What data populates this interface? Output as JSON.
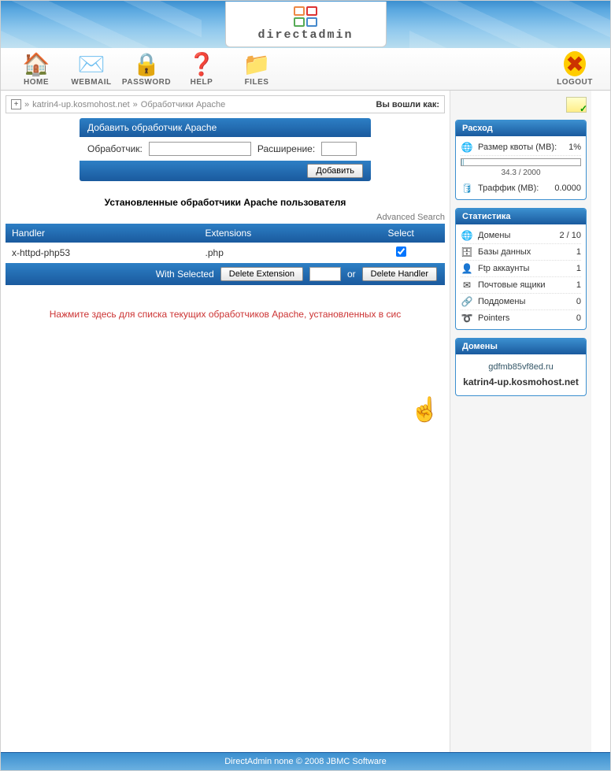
{
  "brand": "directadmin",
  "toolbar": {
    "home": "HOME",
    "webmail": "WEBMAIL",
    "password": "PASSWORD",
    "help": "HELP",
    "files": "FILES",
    "logout": "LOGOUT"
  },
  "breadcrumb": {
    "host": "katrin4-up.kosmohost.net",
    "page": "Обработчики Apache",
    "logged_in_label": "Вы вошли как:"
  },
  "form": {
    "title": "Добавить обработчик Apache",
    "handler_label": "Обработчик:",
    "extension_label": "Расширение:",
    "submit": "Добавить"
  },
  "installed_heading": "Установленные обработчики Apache пользователя",
  "advanced_search": "Advanced Search",
  "table": {
    "col_handler": "Handler",
    "col_extensions": "Extensions",
    "col_select": "Select",
    "rows": [
      {
        "handler": "x-httpd-php53",
        "ext": ".php",
        "selected": true
      }
    ]
  },
  "actions": {
    "with_selected": "With Selected",
    "delete_extension": "Delete Extension",
    "or": "or",
    "delete_handler": "Delete Handler"
  },
  "bottom_link_text": "Нажмите здесь для списка текущих обработчиков Apache, установленных в сис",
  "sidebar": {
    "usage": {
      "title": "Расход",
      "quota_label": "Размер квоты (MB):",
      "quota_pct": "1%",
      "quota_fill_pct": 1.7,
      "quota_text": "34.3 / 2000",
      "traffic_label": "Траффик (MB):",
      "traffic_val": "0.0000"
    },
    "stats": {
      "title": "Статистика",
      "rows": [
        {
          "icon": "🌐",
          "label": "Домены",
          "val": "2 / 10"
        },
        {
          "icon": "🗄",
          "label": "Базы данных",
          "val": "1"
        },
        {
          "icon": "👤",
          "label": "Ftp аккаунты",
          "val": "1"
        },
        {
          "icon": "✉",
          "label": "Почтовые ящики",
          "val": "1"
        },
        {
          "icon": "🔗",
          "label": "Поддомены",
          "val": "0"
        },
        {
          "icon": "➰",
          "label": "Pointers",
          "val": "0"
        }
      ]
    },
    "domains": {
      "title": "Домены",
      "list": [
        "gdfmb85vf8ed.ru"
      ],
      "current": "katrin4-up.kosmohost.net"
    }
  },
  "footer_text": "DirectAdmin none © 2008 JBMC Software"
}
